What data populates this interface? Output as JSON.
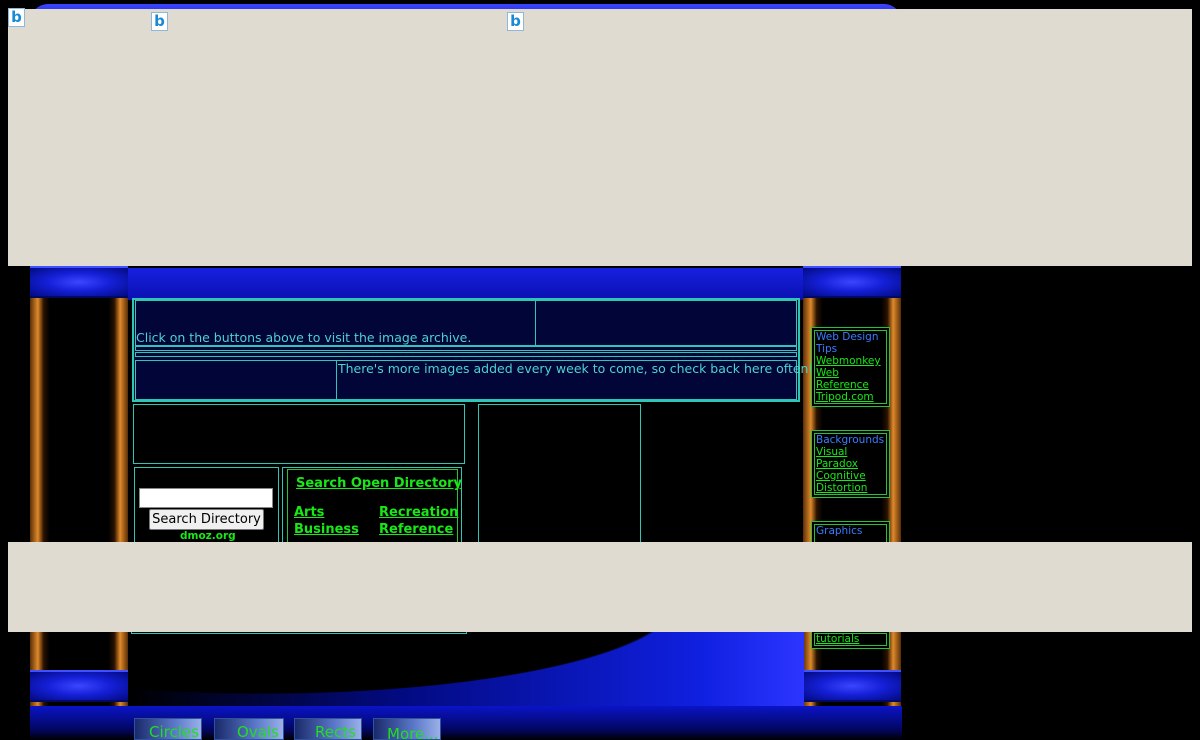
{
  "center": {
    "archive_note": "Click on the buttons above to visit the image archive.",
    "weekly_note": "There's more images added every week to come, so check back here often!"
  },
  "search": {
    "button_label": "Search Directory",
    "credit": "dmoz.org",
    "title": "Search Open Directory",
    "categories": [
      "Arts",
      "Recreation",
      "Business",
      "Reference"
    ]
  },
  "sidebar": {
    "web_design": {
      "heading": "Web Design Tips",
      "links": [
        "Webmonkey",
        "Web Reference",
        "Tripod.com"
      ]
    },
    "backgrounds": {
      "heading": "Backgrounds",
      "links": [
        "Visual Paradox",
        "Cognitive Distortion"
      ]
    },
    "graphics": {
      "heading": "Graphics",
      "tail_link": "tutorials"
    }
  },
  "nav": [
    "Circles",
    "Ovals",
    "Rects",
    "More..."
  ],
  "icons": [
    "broken-image-icon"
  ],
  "colors": {
    "cyan": "#2ec7b5",
    "green": "#18e818",
    "blue": "#3a7cff",
    "overlay": "#dfdbd0"
  }
}
